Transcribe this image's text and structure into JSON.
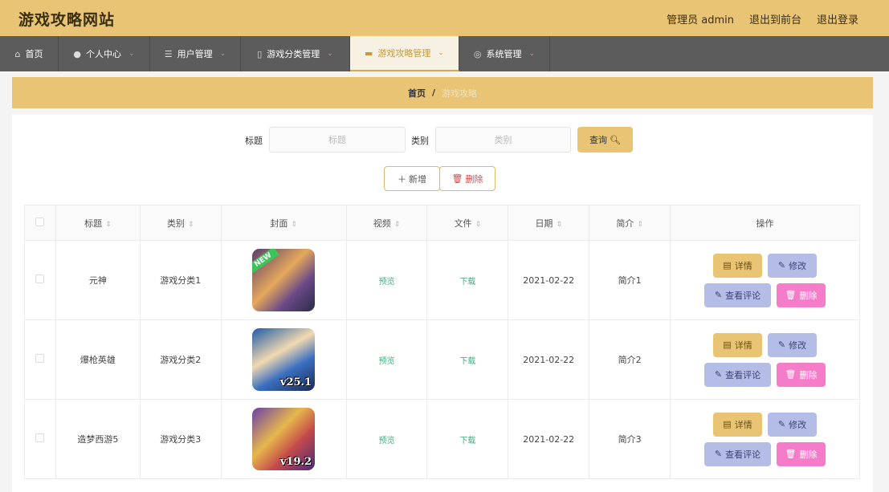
{
  "header": {
    "site_title": "游戏攻略网站",
    "admin_label": "管理员 admin",
    "back_to_front": "退出到前台",
    "logout": "退出登录"
  },
  "nav": {
    "items": [
      {
        "label": "首页",
        "icon": "home-icon"
      },
      {
        "label": "个人中心",
        "icon": "user-icon"
      },
      {
        "label": "用户管理",
        "icon": "sliders-icon"
      },
      {
        "label": "游戏分类管理",
        "icon": "mic-icon"
      },
      {
        "label": "游戏攻略管理",
        "icon": "briefcase-icon",
        "active": true
      },
      {
        "label": "系统管理",
        "icon": "settings-icon"
      }
    ]
  },
  "breadcrumb": {
    "home": "首页",
    "sep": "/",
    "current": "游戏攻略"
  },
  "search": {
    "title_label": "标题",
    "title_placeholder": "标题",
    "category_label": "类别",
    "category_placeholder": "类别",
    "query_button": "查询"
  },
  "actions": {
    "add": "新增",
    "delete": "删除"
  },
  "table": {
    "headers": [
      "标题",
      "类别",
      "封面",
      "视频",
      "文件",
      "日期",
      "简介",
      "操作"
    ],
    "rows": [
      {
        "title": "元神",
        "category": "游戏分类1",
        "video": "预览",
        "file": "下载",
        "date": "2021-02-22",
        "intro": "简介1",
        "cover_badge": "NEW",
        "cover_version": ""
      },
      {
        "title": "爆枪英雄",
        "category": "游戏分类2",
        "video": "预览",
        "file": "下载",
        "date": "2021-02-22",
        "intro": "简介2",
        "cover_badge": "",
        "cover_version": "v25.1"
      },
      {
        "title": "造梦西游5",
        "category": "游戏分类3",
        "video": "预览",
        "file": "下载",
        "date": "2021-02-22",
        "intro": "简介3",
        "cover_badge": "",
        "cover_version": "v19.2"
      }
    ],
    "row_actions": {
      "detail": "详情",
      "edit": "修改",
      "comments": "查看评论",
      "delete": "删除"
    }
  },
  "colors": {
    "header_bg": "#e8c474",
    "nav_bg": "#5c5c5c",
    "detail_btn": "#e8c474",
    "edit_btn": "#b4bde6",
    "delete_btn": "#f57cc8",
    "link_green": "#3fae7a"
  }
}
